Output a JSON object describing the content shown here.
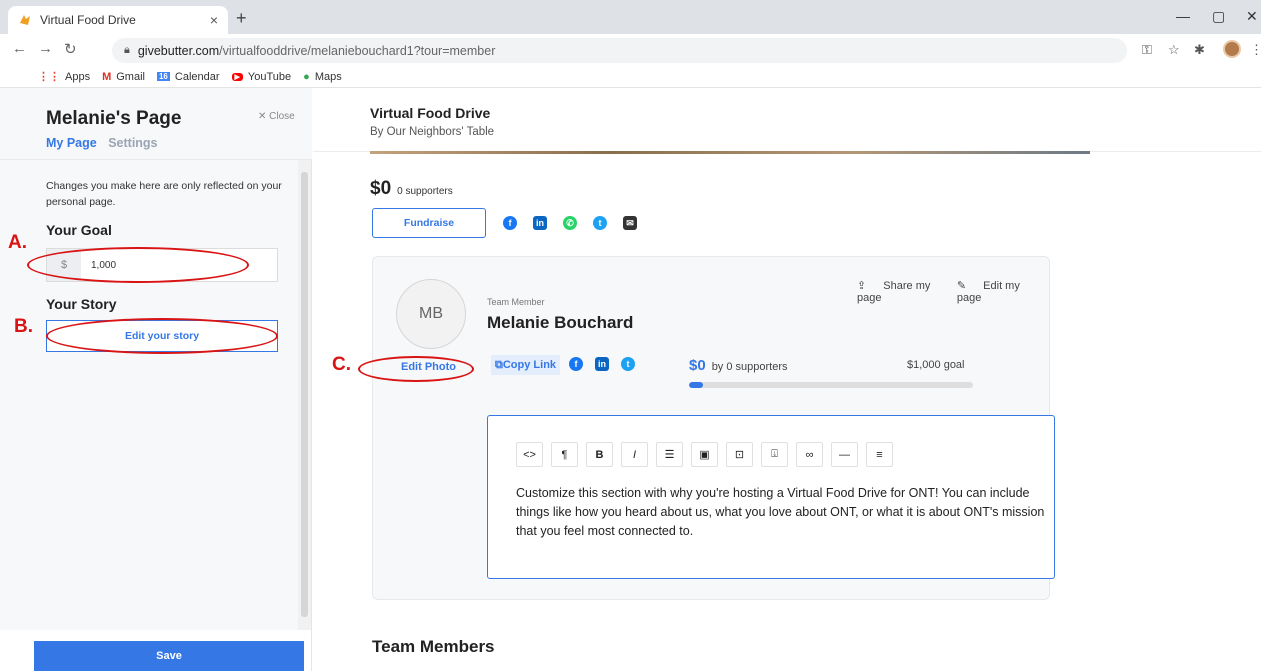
{
  "browser": {
    "tab_title": "Virtual Food Drive",
    "tab_close": "×",
    "new_tab": "+",
    "url_host": "givebutter.com",
    "url_path": "/virtualfooddrive/melaniebouchard1?tour=member",
    "bookmarks": [
      {
        "label": "Apps",
        "icon": "apps-grid-icon"
      },
      {
        "label": "Gmail",
        "icon": "gmail-icon"
      },
      {
        "label": "Calendar",
        "icon": "calendar-icon"
      },
      {
        "label": "YouTube",
        "icon": "youtube-icon"
      },
      {
        "label": "Maps",
        "icon": "maps-icon"
      }
    ]
  },
  "sidebar": {
    "title": "Melanie's Page",
    "close_label": "Close",
    "tabs": [
      {
        "label": "My Page",
        "active": true
      },
      {
        "label": "Settings",
        "active": false
      }
    ],
    "note": "Changes you make here are only reflected on your personal page.",
    "goal_label": "Your Goal",
    "goal_currency": "$",
    "goal_value": "1,000",
    "story_label": "Your Story",
    "story_button": "Edit your story",
    "save_button": "Save"
  },
  "main": {
    "campaign_title": "Virtual Food Drive",
    "campaign_org": "By Our Neighbors' Table",
    "raised_amount": "$0",
    "supporters": "0 supporters",
    "fundraise_button": "Fundraise",
    "share_icons": [
      "facebook-icon",
      "linkedin-icon",
      "whatsapp-icon",
      "twitter-icon",
      "email-icon"
    ],
    "card": {
      "initials": "MB",
      "edit_photo": "Edit Photo",
      "role": "Team Member",
      "name": "Melanie Bouchard",
      "share_page": "Share my page",
      "edit_page": "Edit my page",
      "copy_link": "Copy Link",
      "raised": "$0",
      "by_supporters": "by 0 supporters",
      "goal": "$1,000 goal",
      "progress": 0.05,
      "editor_buttons": [
        "<>",
        "¶",
        "B",
        "I",
        "list",
        "image",
        "video",
        "embed",
        "link",
        "—",
        "align"
      ],
      "story_text": "Customize this section with why you're hosting a Virtual Food Drive for ONT! You can include things like how you heard about us, what you love about ONT, or what it is about ONT's mission that you feel most connected to."
    },
    "team_title": "Team Members"
  },
  "annotations": [
    "A.",
    "B.",
    "C."
  ],
  "colors": {
    "accent": "#3578e5",
    "annotation": "#d91414"
  }
}
